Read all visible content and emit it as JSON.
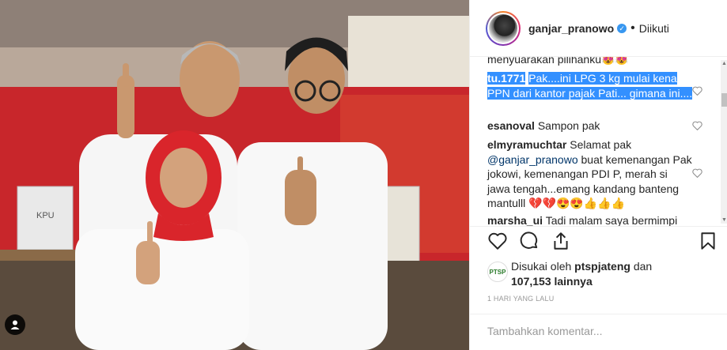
{
  "post": {
    "username": "ganjar_pranowo",
    "verified_mark": "✓",
    "separator": "•",
    "follow_state": "Diikuti"
  },
  "comments": [
    {
      "user": "",
      "text": "menyuarakan pilihanku😻😻"
    },
    {
      "user": "tu.1771",
      "text": "Pak....ini LPG 3 kg mulai kena PPN dari kantor pajak Pati... gimana ini...."
    },
    {
      "user": "esanoval",
      "text": "Sampon pak"
    },
    {
      "user": "elmyramuchtar",
      "text": "Selamat pak",
      "mention": "@ganjar_pranowo",
      "text2": "buat kemenangan Pak jokowi, kemenangan PDI P, merah si jawa tengah...emang kandang banteng mantulll",
      "emoji": "💔💔😍😍👍👍👍"
    },
    {
      "user": "marsha_ui",
      "text": "Tadi malam saya bermimpi"
    }
  ],
  "likes": {
    "avatar_label": "PTSP",
    "prefix": "Disukai oleh",
    "liker": "ptspjateng",
    "conjunction": "dan",
    "count": "107,153 lainnya"
  },
  "timestamp": "1 HARI YANG LALU",
  "comment_box": {
    "placeholder": "Tambahkan komentar..."
  },
  "photo": {
    "ballot_label": "KPU"
  },
  "icons": [
    "user-tag-icon",
    "heart-icon",
    "comment-icon",
    "share-icon",
    "bookmark-icon",
    "verified-icon"
  ],
  "colors": {
    "verified": "#3897f0",
    "highlight": "#3390ff",
    "backdrop": "#c8262b"
  }
}
